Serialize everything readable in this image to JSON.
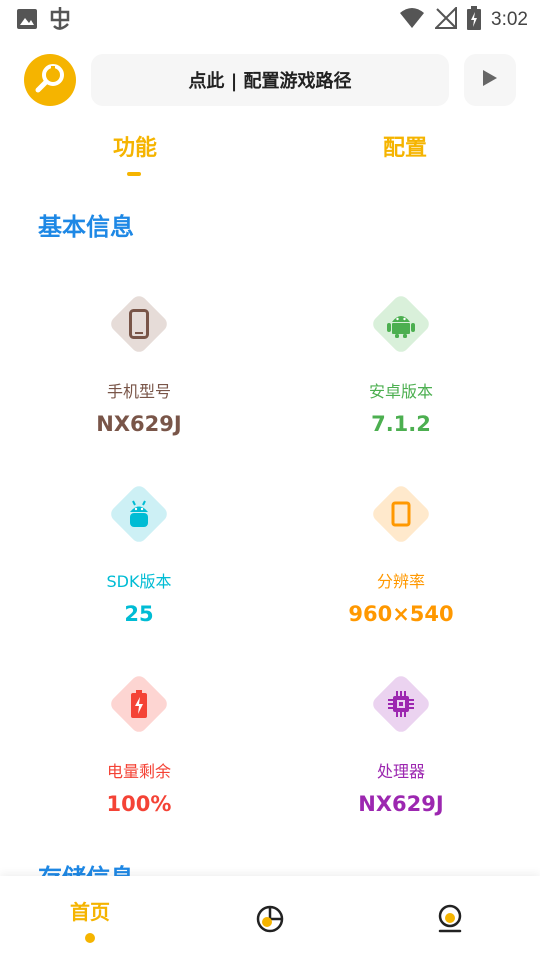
{
  "status_bar": {
    "time": "3:02",
    "left_icons": [
      "image-icon",
      "bug-icon"
    ],
    "right_icons": [
      "wifi-icon",
      "no-signal-icon",
      "battery-charging-icon"
    ]
  },
  "header": {
    "logo_icon": "wrench-icon",
    "path_button_label": "点此 | 配置游戏路径",
    "play_icon": "play-icon"
  },
  "tabs": [
    {
      "label": "功能",
      "active": true
    },
    {
      "label": "配置",
      "active": false
    }
  ],
  "sections": {
    "basic_title": "基本信息",
    "storage_title": "存储信息"
  },
  "basic_info": [
    {
      "label": "手机型号",
      "value": "NX629J",
      "icon": "phone-icon",
      "color": "#795548",
      "bg": "#E6DCD8"
    },
    {
      "label": "安卓版本",
      "value": "7.1.2",
      "icon": "android-icon",
      "color": "#4CAF50",
      "bg": "#D9F0DA"
    },
    {
      "label": "SDK版本",
      "value": "25",
      "icon": "android-robot-icon",
      "color": "#00BCD4",
      "bg": "#CDF0F5"
    },
    {
      "label": "分辨率",
      "value": "960×540",
      "icon": "screen-icon",
      "color": "#FF9800",
      "bg": "#FFE9CC"
    },
    {
      "label": "电量剩余",
      "value": "100%",
      "icon": "battery-icon",
      "color": "#F44336",
      "bg": "#FDD5D2"
    },
    {
      "label": "处理器",
      "value": "NX629J",
      "icon": "chip-icon",
      "color": "#9C27B0",
      "bg": "#EBD3F0"
    }
  ],
  "bottom_nav": {
    "home_label": "首页",
    "stats_icon": "pie-chart-icon",
    "user_icon": "user-icon"
  },
  "colors": {
    "accent": "#F5B400",
    "section_title": "#1E88E5"
  }
}
